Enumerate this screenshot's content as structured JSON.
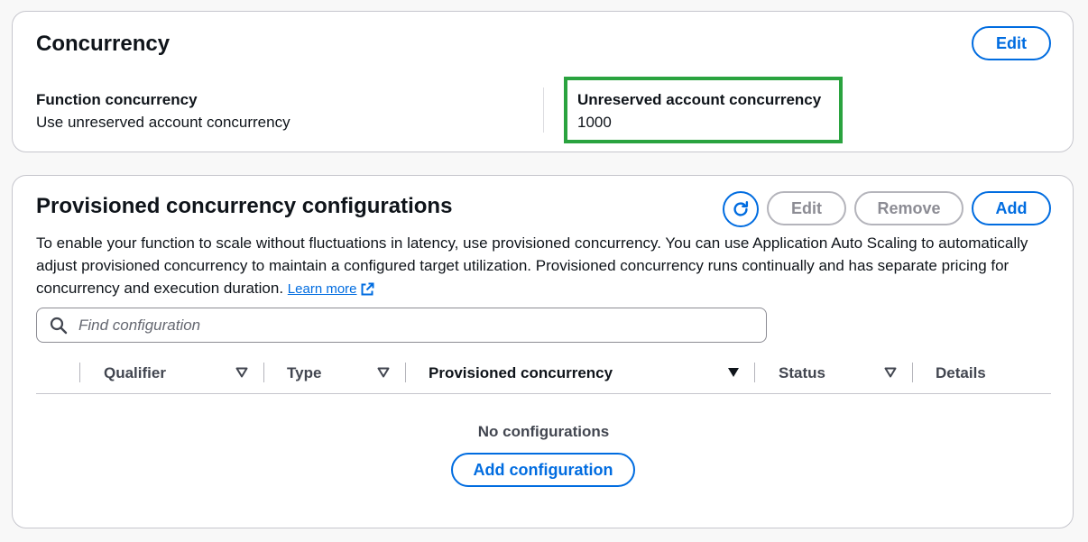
{
  "concurrency": {
    "title": "Concurrency",
    "edit_label": "Edit",
    "function_concurrency": {
      "label": "Function concurrency",
      "value": "Use unreserved account concurrency"
    },
    "unreserved_account_concurrency": {
      "label": "Unreserved account concurrency",
      "value": "1000"
    },
    "highlight_color": "#2aa33f"
  },
  "provisioned": {
    "title": "Provisioned concurrency configurations",
    "buttons": {
      "refresh_icon": "refresh-icon",
      "edit": "Edit",
      "remove": "Remove",
      "add": "Add"
    },
    "description": "To enable your function to scale without fluctuations in latency, use provisioned concurrency. You can use Application Auto Scaling to automatically adjust provisioned concurrency to maintain a configured target utilization. Provisioned concurrency runs continually and has separate pricing for concurrency and execution duration.",
    "learn_more": "Learn more",
    "search_placeholder": "Find configuration",
    "columns": [
      {
        "label": "Qualifier",
        "sortable": true
      },
      {
        "label": "Type",
        "sortable": true
      },
      {
        "label": "Provisioned concurrency",
        "sortable": true,
        "active_sort": true
      },
      {
        "label": "Status",
        "sortable": true
      },
      {
        "label": "Details",
        "sortable": false
      }
    ],
    "empty_text": "No configurations",
    "add_config_label": "Add configuration"
  },
  "colors": {
    "accent": "#006ce0",
    "disabled": "#8c8c94",
    "border": "#c6c6cd"
  }
}
